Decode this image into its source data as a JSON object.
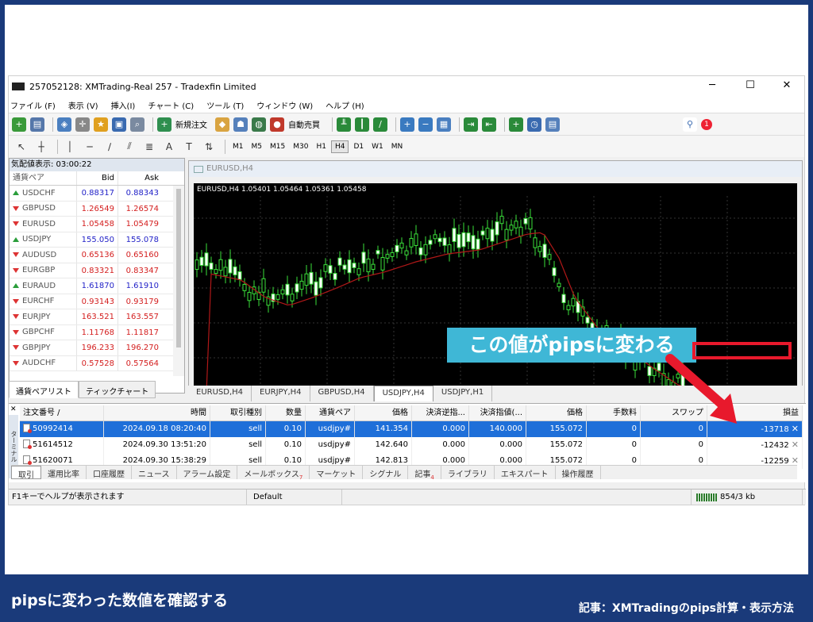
{
  "window": {
    "title": "257052128: XMTrading-Real 257 - Tradexfin Limited",
    "minimize": "─",
    "maximize": "☐",
    "close": "✕"
  },
  "menu": [
    "ファイル (F)",
    "表示 (V)",
    "挿入(I)",
    "チャート (C)",
    "ツール (T)",
    "ウィンドウ (W)",
    "ヘルプ (H)"
  ],
  "toolbar": {
    "new_order": "新規注文",
    "auto_trade": "自動売買"
  },
  "timeframes": [
    "M1",
    "M5",
    "M15",
    "M30",
    "H1",
    "H4",
    "D1",
    "W1",
    "MN"
  ],
  "active_timeframe": "H4",
  "market_watch": {
    "header": "気配値表示: 03:00:22",
    "col_symbol": "通貨ペア",
    "col_bid": "Bid",
    "col_ask": "Ask",
    "rows": [
      {
        "symbol": "USDCHF",
        "bid": "0.88317",
        "ask": "0.88343",
        "dir": "up",
        "color": "#2323c8"
      },
      {
        "symbol": "GBPUSD",
        "bid": "1.26549",
        "ask": "1.26574",
        "dir": "down",
        "color": "#d41e1e"
      },
      {
        "symbol": "EURUSD",
        "bid": "1.05458",
        "ask": "1.05479",
        "dir": "down",
        "color": "#d41e1e"
      },
      {
        "symbol": "USDJPY",
        "bid": "155.050",
        "ask": "155.078",
        "dir": "up",
        "color": "#2323c8"
      },
      {
        "symbol": "AUDUSD",
        "bid": "0.65136",
        "ask": "0.65160",
        "dir": "down",
        "color": "#d41e1e"
      },
      {
        "symbol": "EURGBP",
        "bid": "0.83321",
        "ask": "0.83347",
        "dir": "down",
        "color": "#d41e1e"
      },
      {
        "symbol": "EURAUD",
        "bid": "1.61870",
        "ask": "1.61910",
        "dir": "up",
        "color": "#2323c8"
      },
      {
        "symbol": "EURCHF",
        "bid": "0.93143",
        "ask": "0.93179",
        "dir": "down",
        "color": "#d41e1e"
      },
      {
        "symbol": "EURJPY",
        "bid": "163.521",
        "ask": "163.557",
        "dir": "down",
        "color": "#d41e1e"
      },
      {
        "symbol": "GBPCHF",
        "bid": "1.11768",
        "ask": "1.11817",
        "dir": "down",
        "color": "#d41e1e"
      },
      {
        "symbol": "GBPJPY",
        "bid": "196.233",
        "ask": "196.270",
        "dir": "down",
        "color": "#d41e1e"
      },
      {
        "symbol": "AUDCHF",
        "bid": "0.57528",
        "ask": "0.57564",
        "dir": "down",
        "color": "#d41e1e"
      }
    ],
    "tab_symbols": "通貨ペアリスト",
    "tab_tick": "ティックチャート"
  },
  "chart": {
    "window_title": "EURUSD,H4",
    "label": "EURUSD,H4  1.05401 1.05464 1.05361 1.05458",
    "tabs": [
      "EURUSD,H4",
      "EURJPY,H4",
      "GBPUSD,H4",
      "USDJPY,H4",
      "USDJPY,H1"
    ],
    "active_tab": "USDJPY,H4"
  },
  "callout": "この値がpipsに変わる",
  "terminal": {
    "side_label": "ターミナル",
    "columns": [
      "注文番号 /",
      "時間",
      "取引種別",
      "数量",
      "通貨ペア",
      "価格",
      "決済逆指...",
      "決済指値(...",
      "価格",
      "手数料",
      "スワップ",
      "損益"
    ],
    "rows": [
      [
        "50992414",
        "2024.09.18 08:20:40",
        "sell",
        "0.10",
        "usdjpy#",
        "141.354",
        "0.000",
        "140.000",
        "155.072",
        "0",
        "0",
        "-13718"
      ],
      [
        "51614512",
        "2024.09.30 13:51:20",
        "sell",
        "0.10",
        "usdjpy#",
        "142.640",
        "0.000",
        "0.000",
        "155.072",
        "0",
        "0",
        "-12432"
      ],
      [
        "51620071",
        "2024.09.30 15:38:29",
        "sell",
        "0.10",
        "usdjpy#",
        "142.813",
        "0.000",
        "0.000",
        "155.072",
        "0",
        "0",
        "-12259"
      ]
    ],
    "tabs": [
      "取引",
      "運用比率",
      "口座履歴",
      "ニュース",
      "アラーム設定",
      "メールボックス",
      "マーケット",
      "シグナル",
      "記事",
      "ライブラリ",
      "エキスパート",
      "操作履歴"
    ],
    "mail_count": "7",
    "article_count": "4"
  },
  "status": {
    "help": "F1キーでヘルプが表示されます",
    "profile": "Default",
    "traffic": "854/3 kb"
  },
  "footer": {
    "left": "pipsに変わった数値を確認する",
    "right": "記事：XMTradingのpips計算・表示方法"
  }
}
